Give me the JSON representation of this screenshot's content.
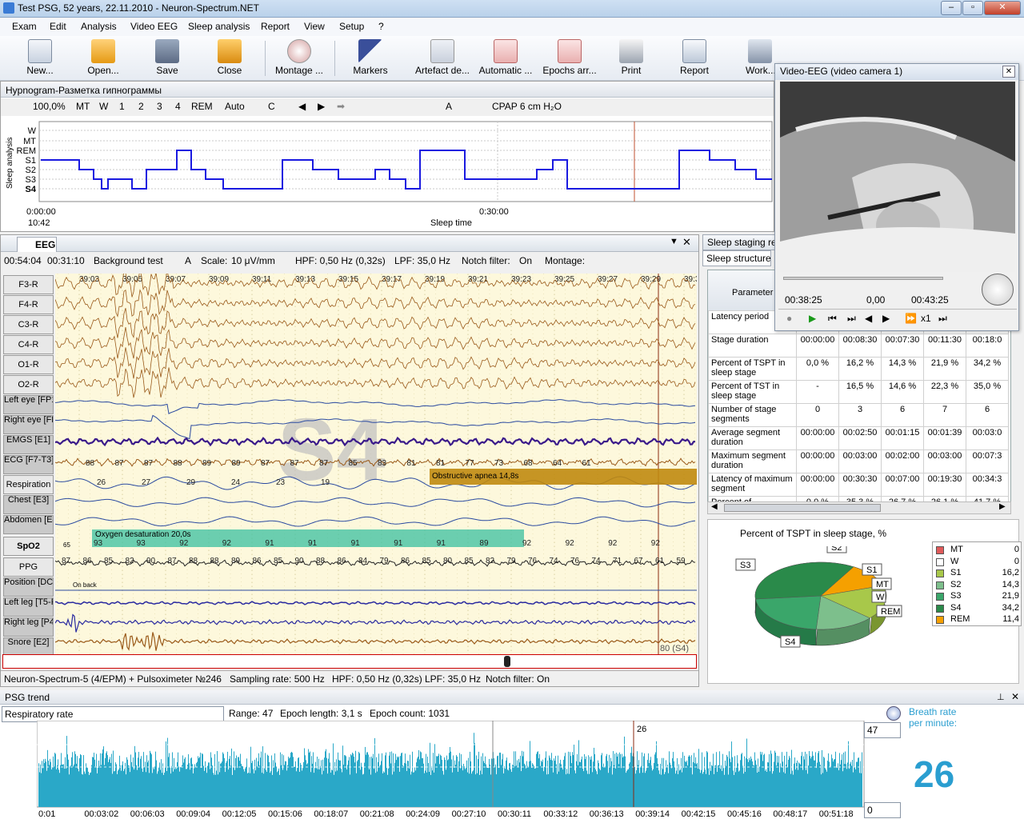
{
  "window": {
    "title": "Test PSG, 52 years, 22.11.2010 - Neuron-Spectrum.NET"
  },
  "menu": [
    "Exam",
    "Edit",
    "Analysis",
    "Video EEG",
    "Sleep analysis",
    "Report",
    "View",
    "Setup",
    "?"
  ],
  "toolbar": [
    "New...",
    "Open...",
    "Save",
    "Close",
    "Montage ...",
    "Markers",
    "Artefact de...",
    "Automatic ...",
    "Epochs arr...",
    "Print",
    "Report",
    "Work..."
  ],
  "hypnogram": {
    "title": "Hypnogram-Разметка гипнограммы",
    "zoom": "100,0%",
    "stage_buttons": [
      "MT",
      "W",
      "1",
      "2",
      "3",
      "4",
      "REM"
    ],
    "auto": "Auto",
    "mode": "C",
    "cpap": "CPAP 6 cm H₂O",
    "yaxis_title": "Sleep analysis",
    "stages": [
      "W",
      "MT",
      "REM",
      "S1",
      "S2",
      "S3",
      "S4"
    ],
    "t0": "0:00:00",
    "t0_clock": "10:42",
    "t1": "0:30:00",
    "xlabel": "Sleep time"
  },
  "eeg": {
    "tab": "EEG",
    "time_pos": "00:54:04",
    "time_span": "00:31:10",
    "test": "Background test",
    "a_label": "A",
    "scale_label": "Scale:",
    "scale": "10 μV/mm",
    "hpf": "HPF: 0,50 Hz (0,32s)",
    "lpf": "LPF: 35,0 Hz",
    "notch_label": "Notch filter:",
    "notch": "On",
    "montage_label": "Montage:",
    "time_ticks": [
      "39:03",
      "39:05",
      "39:07",
      "39:09",
      "39:11",
      "39:13",
      "39:15",
      "39:17",
      "39:19",
      "39:21",
      "39:23",
      "39:25",
      "39:27",
      "39:29",
      "39:3"
    ],
    "channels": [
      "F3-R",
      "F4-R",
      "C3-R",
      "C4-R",
      "O1-R",
      "O2-R",
      "Left eye [FP1-R]",
      "Right eye [FP2-R]",
      "EMGS [E1]",
      "ECG [F7-T3]",
      "Respiration",
      "Chest [E3]",
      "Abdomen [E4]",
      "SpO2",
      "PPG",
      "Position [DC1]",
      "Left leg [T5-P3]",
      "Right leg [P4-T6]",
      "Snore [E2]"
    ],
    "stage_watermark": "S4",
    "ecg_values": [
      "88",
      "87",
      "87",
      "88",
      "89",
      "89",
      "87",
      "87",
      "87",
      "85",
      "83",
      "81",
      "81",
      "77",
      "73",
      "68",
      "64",
      "61"
    ],
    "resp_values": [
      "26",
      "27",
      "29",
      "24",
      "23",
      "19"
    ],
    "apnea_label": "Obstructive apnea 14,8s",
    "desat_label": "Oxygen desaturation 20,0s",
    "spo2_values": [
      "93",
      "93",
      "92",
      "92",
      "91",
      "91",
      "91",
      "91",
      "91",
      "89",
      "92",
      "92",
      "92",
      "92"
    ],
    "spo2_scale": "65",
    "ppg_values": [
      "87",
      "86",
      "85",
      "82",
      "90",
      "87",
      "88",
      "88",
      "89",
      "86",
      "85",
      "90",
      "88",
      "86",
      "84",
      "79",
      "86",
      "85",
      "80",
      "85",
      "82",
      "79",
      "76",
      "74",
      "76",
      "74",
      "71",
      "67",
      "61",
      "59"
    ],
    "position_note": "On back",
    "epoch_label": "80 (S4)",
    "status": [
      "Neuron-Spectrum-5 (4/EPM) + Pulsoximeter №246",
      "Sampling rate: 500 Hz",
      "HPF: 0,50 Hz (0,32s)",
      "LPF: 35,0 Hz",
      "Notch filter: On"
    ]
  },
  "video": {
    "title": "Video-EEG (video camera 1)",
    "t_current": "00:38:25",
    "t_mid": "0,00",
    "t_end": "00:43:25",
    "speed": "x1"
  },
  "sleep_staging": {
    "title": "Sleep staging re",
    "tab": "Sleep structure",
    "param_header": "Parameter",
    "rows": [
      {
        "label": "Latency period",
        "values": [
          "",
          "",
          "",
          "",
          ""
        ]
      },
      {
        "label": "Stage duration",
        "values": [
          "00:00:00",
          "00:08:30",
          "00:07:30",
          "00:11:30",
          "00:18:0"
        ]
      },
      {
        "label": "Percent of TSPT in sleep stage",
        "values": [
          "0,0 %",
          "16,2 %",
          "14,3 %",
          "21,9 %",
          "34,2 %"
        ]
      },
      {
        "label": "Percent of TST in sleep stage",
        "values": [
          "-",
          "16,5 %",
          "14,6 %",
          "22,3 %",
          "35,0 %"
        ]
      },
      {
        "label": "Number of stage segments",
        "values": [
          "0",
          "3",
          "6",
          "7",
          "6"
        ]
      },
      {
        "label": "Average segment duration",
        "values": [
          "00:00:00",
          "00:02:50",
          "00:01:15",
          "00:01:39",
          "00:03:0"
        ]
      },
      {
        "label": "Maximum segment duration",
        "values": [
          "00:00:00",
          "00:03:00",
          "00:02:00",
          "00:03:00",
          "00:07:3"
        ]
      },
      {
        "label": "Latency of maximum segment",
        "values": [
          "00:00:00",
          "00:30:30",
          "00:07:00",
          "00:19:30",
          "00:34:3"
        ]
      },
      {
        "label": "Percent of",
        "values": [
          "0,0 %",
          "35,3 %",
          "26,7 %",
          "26,1 %",
          "41,7 %"
        ]
      }
    ]
  },
  "chart_data": {
    "type": "pie",
    "title": "Percent of TSPT in sleep stage, %",
    "categories": [
      "MT",
      "W",
      "S1",
      "S2",
      "S3",
      "S4",
      "REM"
    ],
    "values": [
      0,
      0,
      16.2,
      14.3,
      21.9,
      34.2,
      11.4
    ],
    "value_labels": [
      "0",
      "0",
      "16,2",
      "14,3",
      "21,9",
      "34,2",
      "11,4"
    ],
    "colors": [
      "#e05a5a",
      "#ffffff",
      "#a8c84a",
      "#7dbf8c",
      "#3aa66a",
      "#2a8a4a",
      "#f5a000"
    ],
    "slice_labels": [
      "S1",
      "S2",
      "S3",
      "S4",
      "MT",
      "W",
      "REM"
    ]
  },
  "trend": {
    "title": "PSG trend",
    "parameter": "Respiratory rate",
    "range": "Range: 47",
    "epoch_length": "Epoch length: 3,1 s",
    "epoch_count": "Epoch count: 1031",
    "ymax": "47",
    "ymin": "0",
    "marker_value": "26",
    "breath_title": "Breath rate per minute:",
    "breath_value": "26",
    "xticks": [
      "0:01",
      "00:03:02",
      "00:06:03",
      "00:09:04",
      "00:12:05",
      "00:15:06",
      "00:18:07",
      "00:21:08",
      "00:24:09",
      "00:27:10",
      "00:30:11",
      "00:33:12",
      "00:36:13",
      "00:39:14",
      "00:42:15",
      "00:45:16",
      "00:48:17",
      "00:51:18"
    ]
  }
}
